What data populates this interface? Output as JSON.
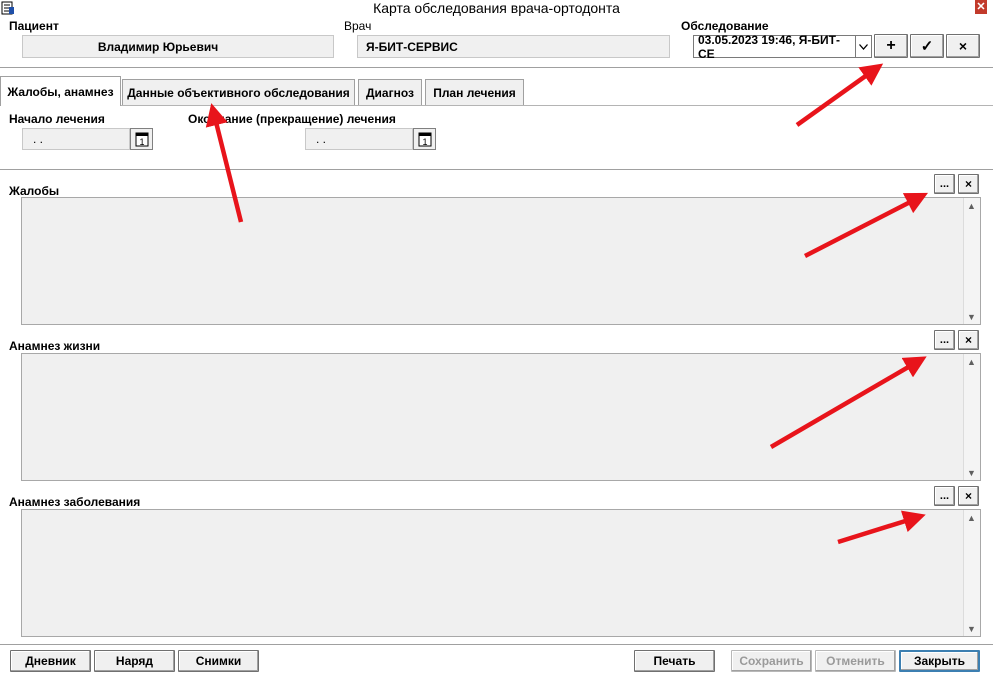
{
  "window": {
    "title": "Карта обследования врача-ортодонта",
    "close_glyph": "✕"
  },
  "header": {
    "patient_label": "Пациент",
    "patient_value": "Владимир Юрьевич",
    "doctor_label": "Врач",
    "doctor_value": "Я-БИТ-СЕРВИС",
    "exam_label": "Обследование",
    "exam_value": "03.05.2023 19:46, Я-БИТ-СЕ",
    "add_glyph": "+",
    "confirm_glyph": "✓",
    "delete_glyph": "×"
  },
  "tabs": [
    {
      "label": "Жалобы, анамнез",
      "active": true
    },
    {
      "label": "Данные объективного обследования",
      "active": false
    },
    {
      "label": "Диагноз",
      "active": false
    },
    {
      "label": "План лечения",
      "active": false
    }
  ],
  "treatment": {
    "start_label": "Начало лечения",
    "start_value": ". .",
    "end_label": "Окончание (прекращение) лечения",
    "end_value": ". .",
    "calendar_glyph": "1"
  },
  "sections": [
    {
      "label": "Жалобы",
      "ellipsis_glyph": "...",
      "clear_glyph": "×",
      "value": ""
    },
    {
      "label": "Анамнез жизни",
      "ellipsis_glyph": "...",
      "clear_glyph": "×",
      "value": ""
    },
    {
      "label": "Анамнез заболевания",
      "ellipsis_glyph": "...",
      "clear_glyph": "×",
      "value": ""
    }
  ],
  "footer": {
    "diary": "Дневник",
    "order": "Наряд",
    "images": "Снимки",
    "print": "Печать",
    "save": "Сохранить",
    "cancel": "Отменить",
    "close": "Закрыть"
  },
  "colors": {
    "annotation_arrow": "#e8141b",
    "focus_border": "#3c7fb1",
    "panel_bg": "#f0f0f0"
  }
}
